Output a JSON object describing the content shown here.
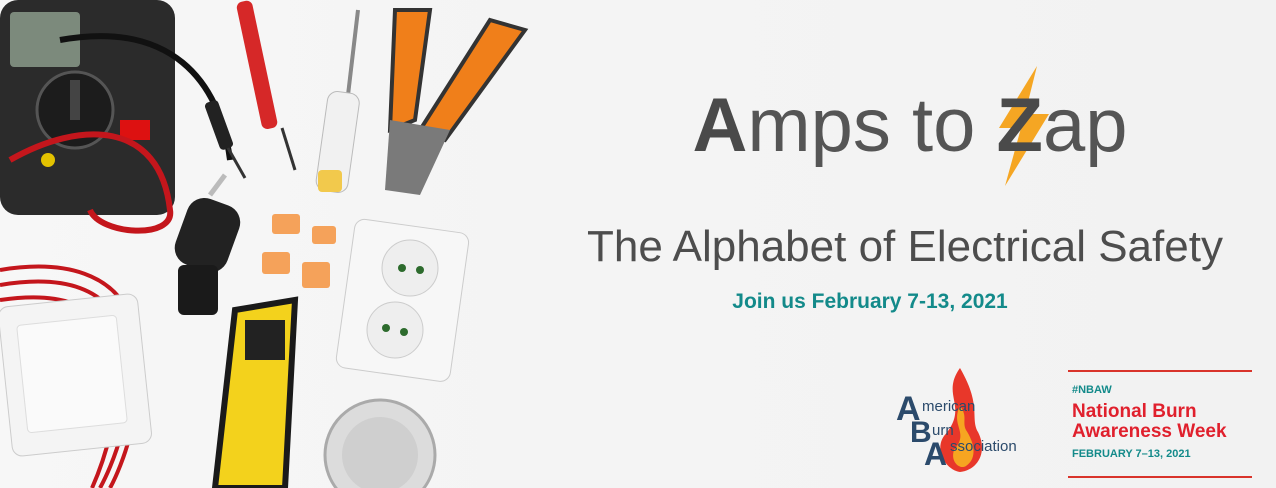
{
  "title": {
    "prefix_big": "A",
    "prefix_rest": "mps to ",
    "z_letter": "Z",
    "suffix": "ap"
  },
  "subtitle": "The Alphabet of Electrical Safety",
  "date_line": "Join us February 7-13, 2021",
  "aba_logo": {
    "line1": "merican",
    "line2": "urn",
    "line3": "ssociation",
    "letters": [
      "A",
      "B",
      "A"
    ]
  },
  "nbaw": {
    "hashtag": "#NBAW",
    "name_line1": "National Burn",
    "name_line2": "Awareness Week",
    "dates": "FEBRUARY 7–13, 2021"
  },
  "colors": {
    "teal": "#138a8a",
    "red": "#e0202d",
    "orange": "#f5a623",
    "title_gray": "#555555"
  },
  "icons": [
    "multimeter-icon",
    "probe-icon",
    "screwdriver-icon",
    "pliers-icon",
    "plug-icon",
    "connector-icon",
    "socket-icon",
    "wire-stripper-icon",
    "switch-icon",
    "junction-box-icon",
    "lightning-bolt-icon",
    "flame-icon"
  ]
}
